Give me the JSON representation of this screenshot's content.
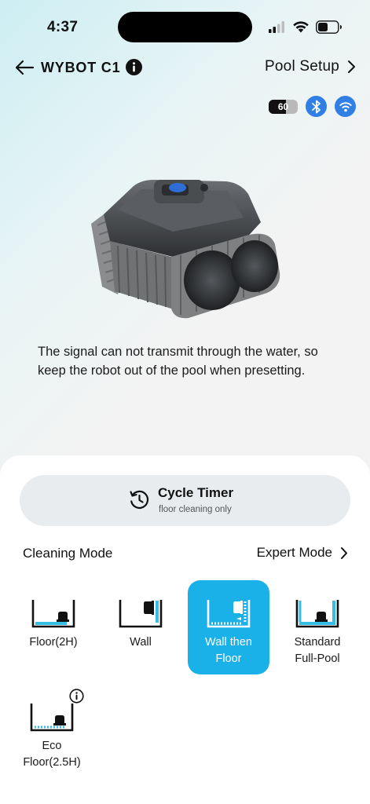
{
  "status_bar": {
    "time": "4:37"
  },
  "header": {
    "device_name": "WYBOT C1",
    "setup_label": "Pool Setup"
  },
  "indicators": {
    "battery_level": "60",
    "battery_fraction": 0.6,
    "icons": [
      "bluetooth-icon",
      "wifi-icon"
    ]
  },
  "notice": "The signal can not transmit through the water, so keep the robot out of the pool when presetting.",
  "cycle_timer": {
    "title": "Cycle Timer",
    "subtitle": "floor cleaning only"
  },
  "cleaning_mode": {
    "title": "Cleaning Mode",
    "expert_label": "Expert Mode",
    "modes": [
      {
        "label": "Floor(2H)",
        "selected": false
      },
      {
        "label": "Wall",
        "selected": false
      },
      {
        "label": "Wall then\nFloor",
        "selected": true
      },
      {
        "label": "Standard\nFull-Pool",
        "selected": false
      },
      {
        "label": "Eco\nFloor(2.5H)",
        "selected": false
      }
    ]
  },
  "colors": {
    "accent": "#1ab0e8",
    "blue_icon": "#2f7fe4",
    "water": "#35bde6"
  }
}
